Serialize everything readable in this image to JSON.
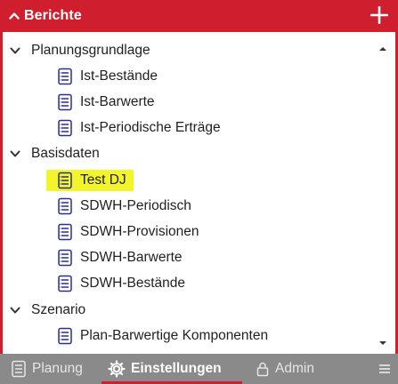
{
  "header": {
    "title": "Berichte",
    "accent_color": "#cf1f2e",
    "collapse_icon": "chevron-up-icon",
    "add_icon": "plus-icon"
  },
  "tree": {
    "groups": [
      {
        "label": "Planungsgrundlage",
        "items": [
          "Ist-Bestände",
          "Ist-Barwerte",
          "Ist-Periodische Erträge"
        ]
      },
      {
        "label": "Basisdaten",
        "items": [
          "Test DJ",
          "SDWH-Periodisch",
          "SDWH-Provisionen",
          "SDWH-Barwerte",
          "SDWH-Bestände"
        ]
      },
      {
        "label": "Szenario",
        "items": [
          "Plan-Barwertige Komponenten"
        ]
      }
    ],
    "highlight_color": "#f3f52a"
  },
  "footer": {
    "tabs": [
      {
        "label": "Planung",
        "icon": "report-icon"
      },
      {
        "label": "Einstellungen",
        "icon": "gear-icon"
      },
      {
        "label": "Admin",
        "icon": "lock-icon"
      }
    ],
    "active_tab": "Einstellungen",
    "menu_icon": "hamburger-icon"
  }
}
